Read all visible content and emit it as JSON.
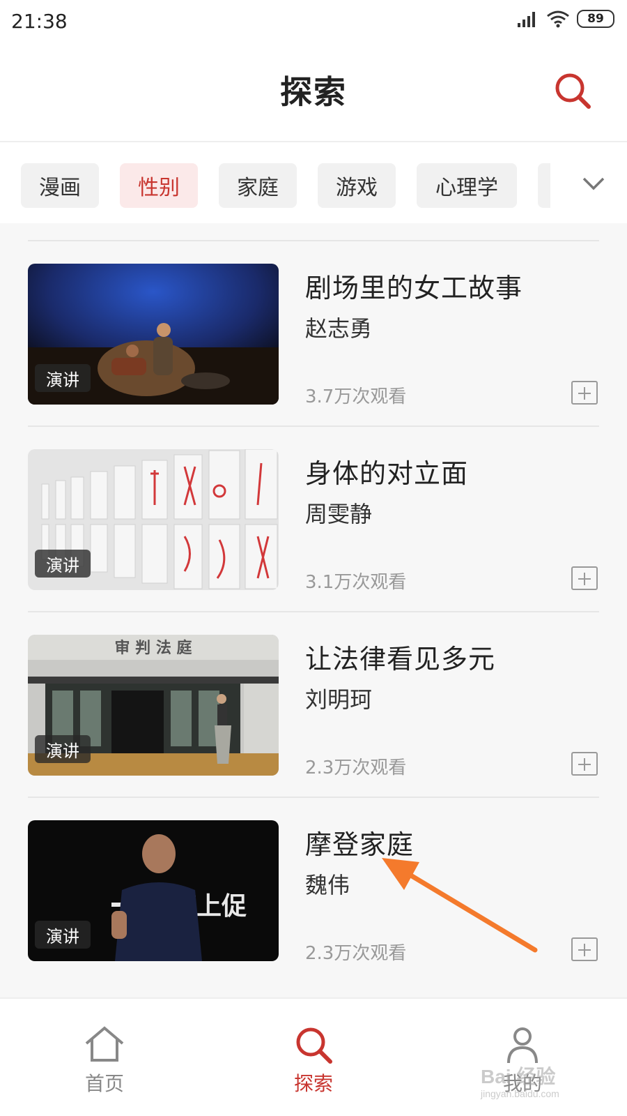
{
  "status_bar": {
    "time": "21:38",
    "battery": "89"
  },
  "header": {
    "title": "探索",
    "search_icon": "search-icon"
  },
  "categories": {
    "items": [
      {
        "label": "漫画",
        "active": false
      },
      {
        "label": "性别",
        "active": true
      },
      {
        "label": "家庭",
        "active": false
      },
      {
        "label": "游戏",
        "active": false
      },
      {
        "label": "心理学",
        "active": false
      }
    ],
    "expand_icon": "chevron-down-icon"
  },
  "videos": [
    {
      "title": "剧场里的女工故事",
      "speaker": "赵志勇",
      "views": "3.7万次观看",
      "badge": "演讲"
    },
    {
      "title": "身体的对立面",
      "speaker": "周雯静",
      "views": "3.1万次观看",
      "badge": "演讲"
    },
    {
      "title": "让法律看见多元",
      "speaker": "刘明珂",
      "views": "2.3万次观看",
      "badge": "演讲",
      "sign_text": "审 判 法 庭"
    },
    {
      "title": "摩登家庭",
      "speaker": "魏伟",
      "views": "2.3万次观看",
      "badge": "演讲",
      "stage_text": "度上促"
    }
  ],
  "bottom_nav": [
    {
      "label": "首页",
      "icon": "home-icon",
      "active": false
    },
    {
      "label": "探索",
      "icon": "search-icon",
      "active": true
    },
    {
      "label": "我的",
      "icon": "user-icon",
      "active": false
    }
  ],
  "watermark": {
    "text": "Bai 经验",
    "url": "jingyan.baidu.com"
  },
  "colors": {
    "accent": "#c8352f",
    "annotation_arrow": "#f47a2c",
    "chip_bg": "#f1f1f1",
    "chip_active_bg": "#fbe9e9"
  }
}
